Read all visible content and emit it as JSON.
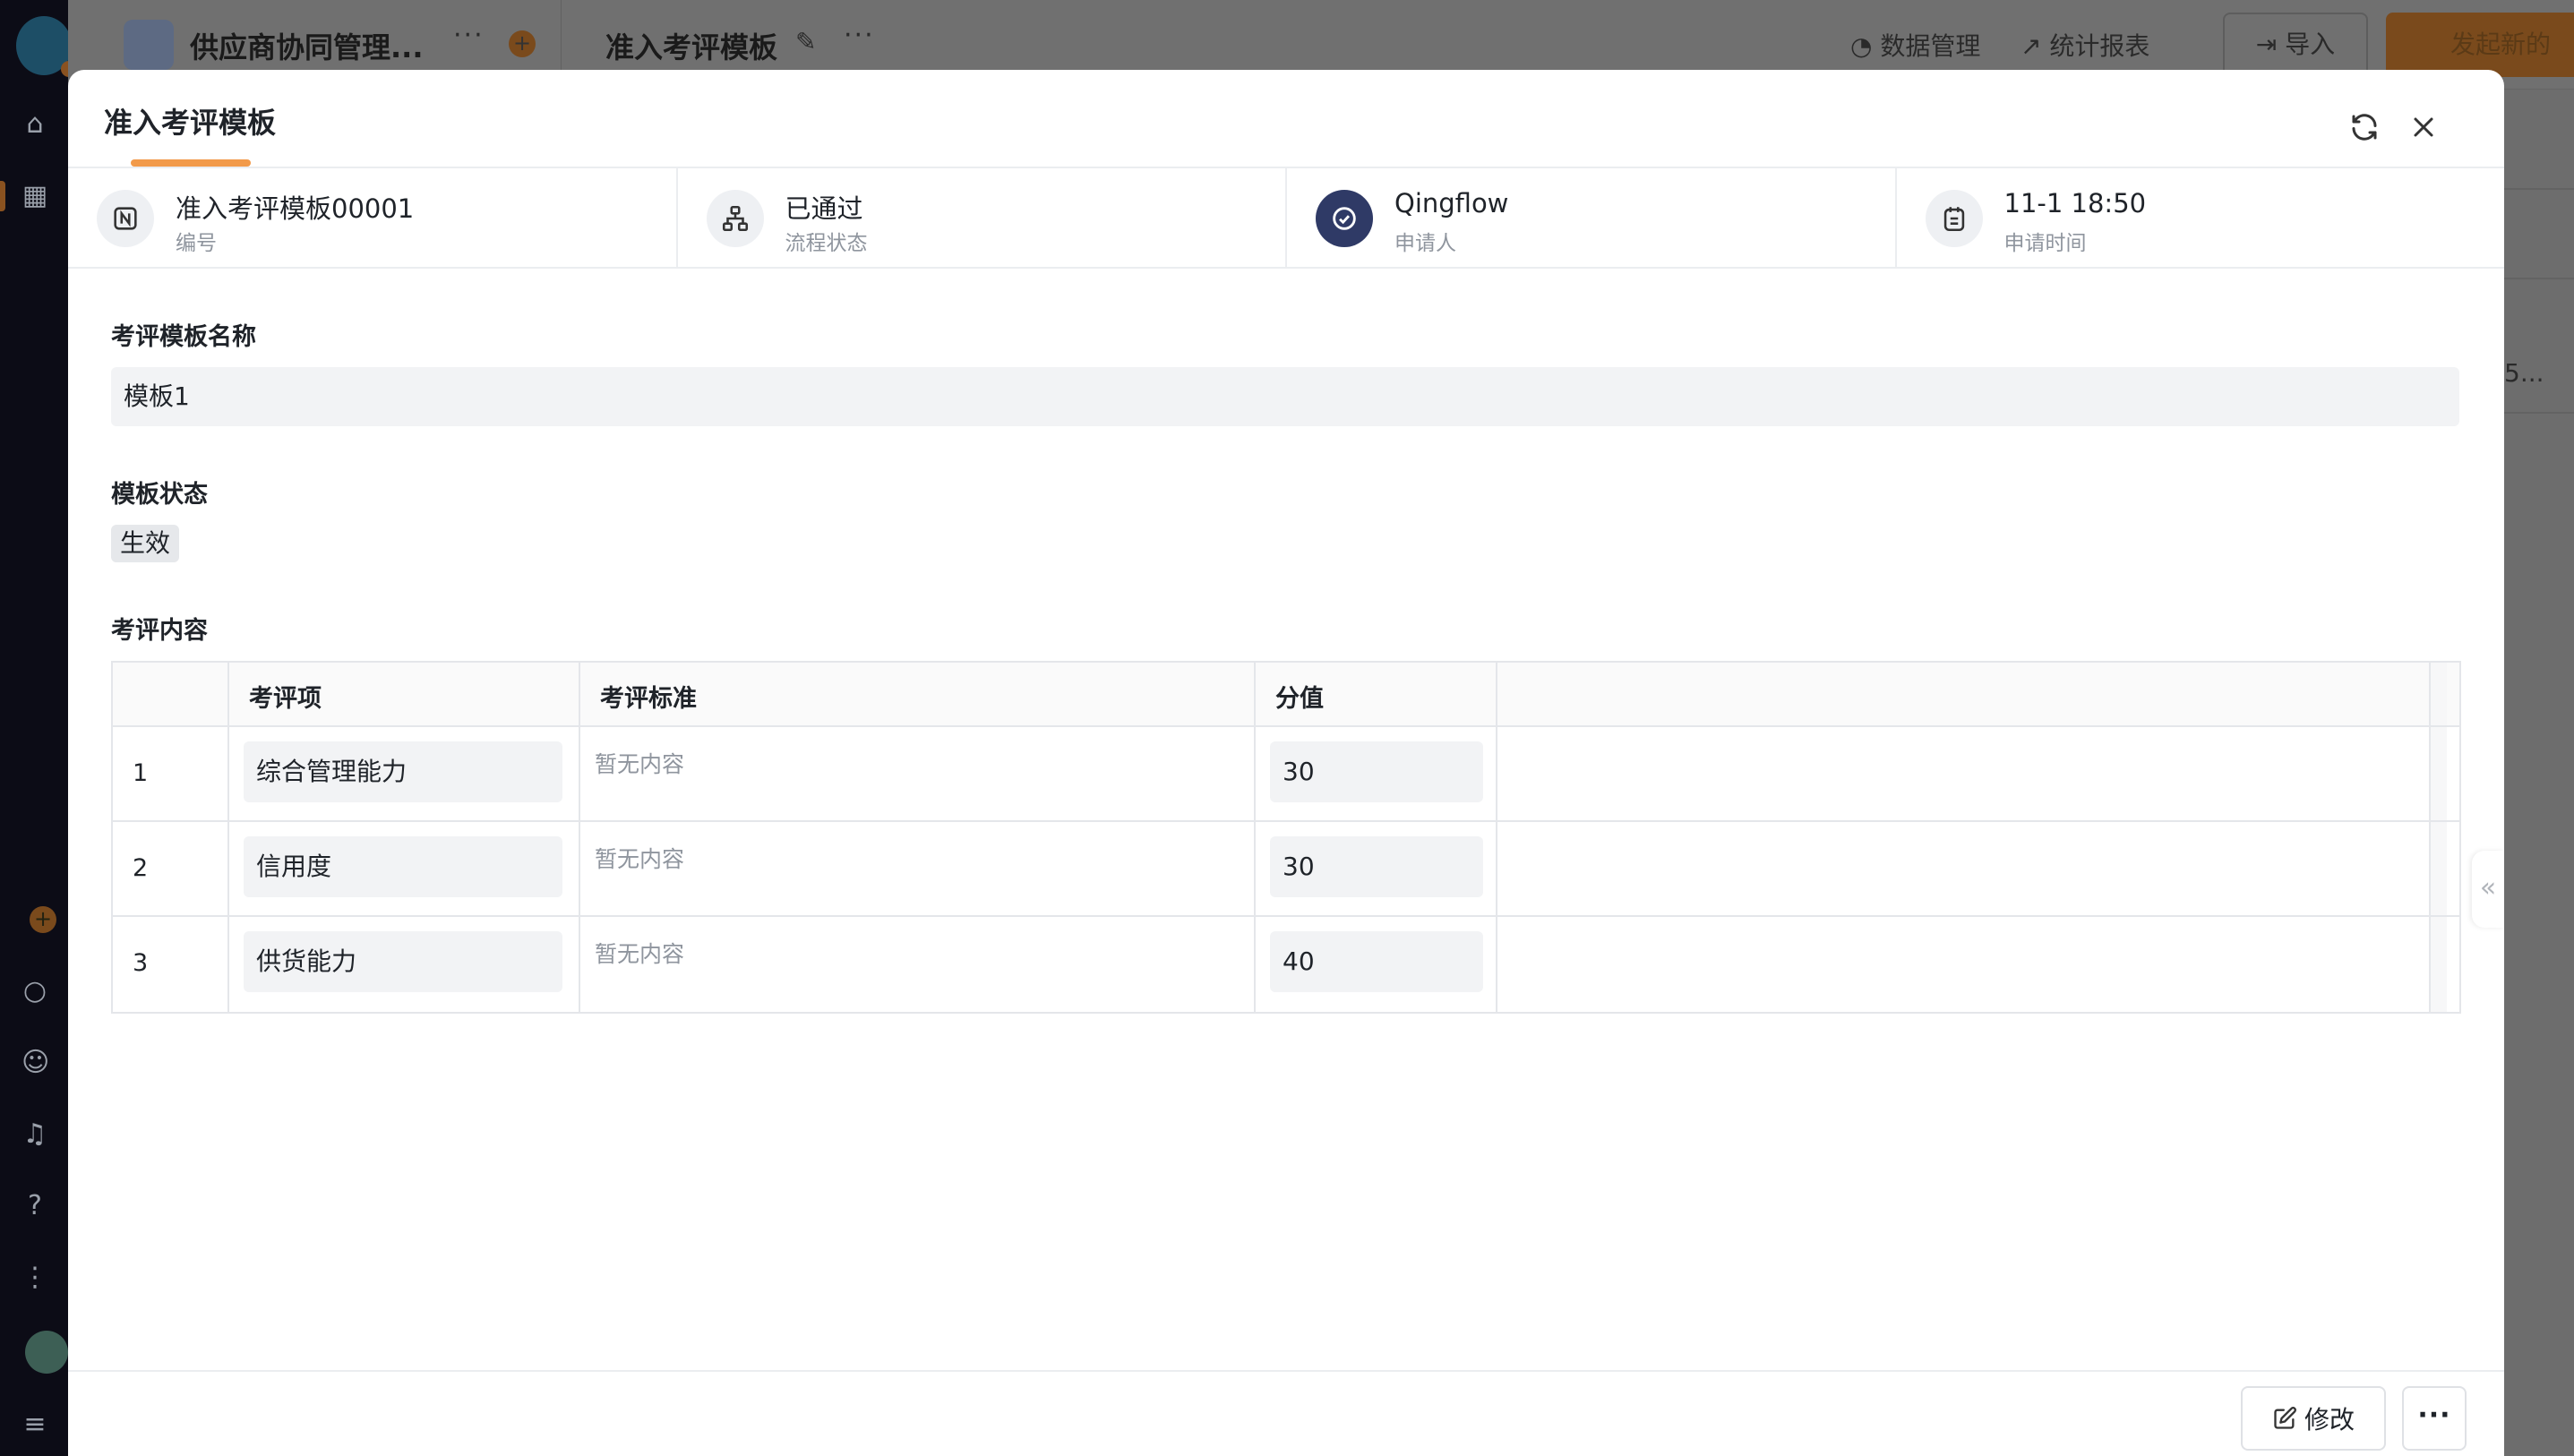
{
  "background": {
    "app_name": "供应商协同管理...",
    "form_name": "准入考评模板",
    "links": {
      "data_mgmt": "数据管理",
      "reports": "统计报表"
    },
    "import_label": "导入",
    "new_label": "发起新的",
    "truncated_cell": "5..."
  },
  "modal": {
    "tab_title": "准入考评模板",
    "meta": [
      {
        "value": "准入考评模板00001",
        "label": "编号"
      },
      {
        "value": "已通过",
        "label": "流程状态"
      },
      {
        "value": "Qingflow",
        "label": "申请人"
      },
      {
        "value": "11-1 18:50",
        "label": "申请时间"
      }
    ],
    "fields": {
      "template_name_label": "考评模板名称",
      "template_name_value": "模板1",
      "status_label": "模板状态",
      "status_value": "生效",
      "content_label": "考评内容"
    },
    "table": {
      "headers": [
        "考评项",
        "考评标准",
        "分值"
      ],
      "rows": [
        {
          "idx": "1",
          "item": "综合管理能力",
          "standard": "暂无内容",
          "score": "30"
        },
        {
          "idx": "2",
          "item": "信用度",
          "standard": "暂无内容",
          "score": "30"
        },
        {
          "idx": "3",
          "item": "供货能力",
          "standard": "暂无内容",
          "score": "40"
        }
      ]
    },
    "footer": {
      "edit_label": "修改",
      "more_label": "···"
    }
  }
}
